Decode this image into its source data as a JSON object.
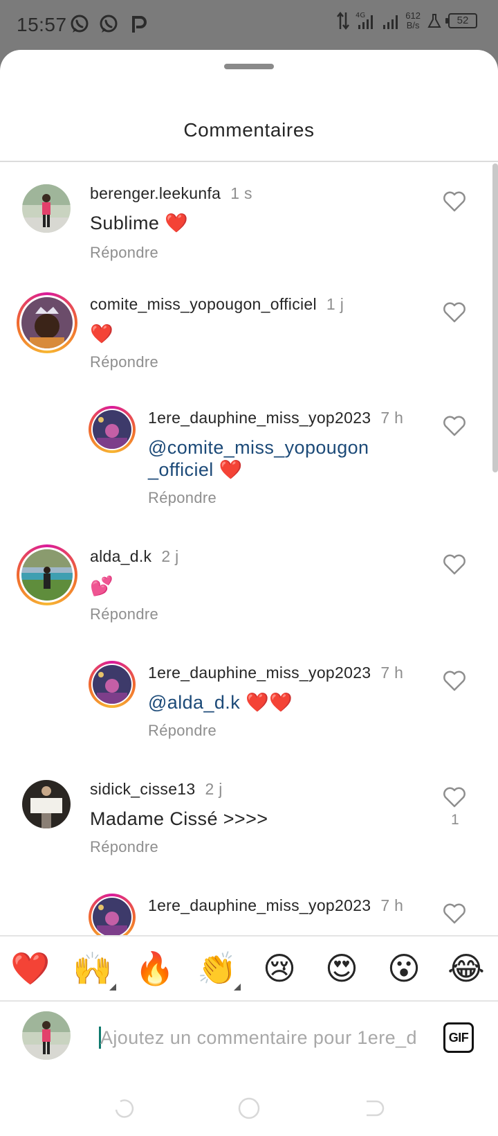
{
  "status_bar": {
    "time": "15:57",
    "network": "4G",
    "speed_value": "612",
    "speed_unit": "B/s",
    "battery": "52",
    "app_icons": [
      "whatsapp-icon",
      "whatsapp-business-icon",
      "p-app-icon"
    ]
  },
  "sheet": {
    "title": "Commentaires"
  },
  "comments": [
    {
      "username": "berenger.leekunfa",
      "time": "1 s",
      "text": "Sublime ❤️",
      "mention": "",
      "reply_label": "Répondre",
      "story_ring": false,
      "like_count": ""
    },
    {
      "username": "comite_miss_yopougon_officiel",
      "time": "1 j",
      "text": "❤️",
      "mention": "",
      "reply_label": "Répondre",
      "story_ring": true,
      "like_count": ""
    },
    {
      "username": "1ere_dauphine_miss_yop2023",
      "time": "7 h",
      "mention_line1": "@comite_miss_yopougon",
      "mention_line2": "_officiel",
      "text": " ❤️",
      "reply_label": "Répondre",
      "story_ring": true,
      "like_count": ""
    },
    {
      "username": "alda_d.k",
      "time": "2 j",
      "text": "💕",
      "mention": "",
      "reply_label": "Répondre",
      "story_ring": true,
      "like_count": ""
    },
    {
      "username": "1ere_dauphine_miss_yop2023",
      "time": "7 h",
      "mention": "@alda_d.k",
      "text": " ❤️❤️",
      "reply_label": "Répondre",
      "story_ring": true,
      "like_count": ""
    },
    {
      "username": "sidick_cisse13",
      "time": "2 j",
      "text": "Madame Cissé >>>>",
      "mention": "",
      "reply_label": "Répondre",
      "story_ring": false,
      "like_count": "1"
    },
    {
      "username": "1ere_dauphine_miss_yop2023",
      "time": "7 h",
      "text": "",
      "mention": "",
      "reply_label": "",
      "story_ring": true,
      "like_count": ""
    }
  ],
  "emoji_bar": [
    "❤️",
    "🙌",
    "🔥",
    "👏",
    "😢",
    "😍",
    "😮",
    "😂"
  ],
  "composer": {
    "placeholder": "Ajoutez un commentaire pour 1ere_d",
    "gif_label": "GIF"
  },
  "colors": {
    "mention": "#1c4a78",
    "muted": "#8e8e8e",
    "ring_start": "#d91a9b",
    "ring_end": "#f7b733"
  }
}
